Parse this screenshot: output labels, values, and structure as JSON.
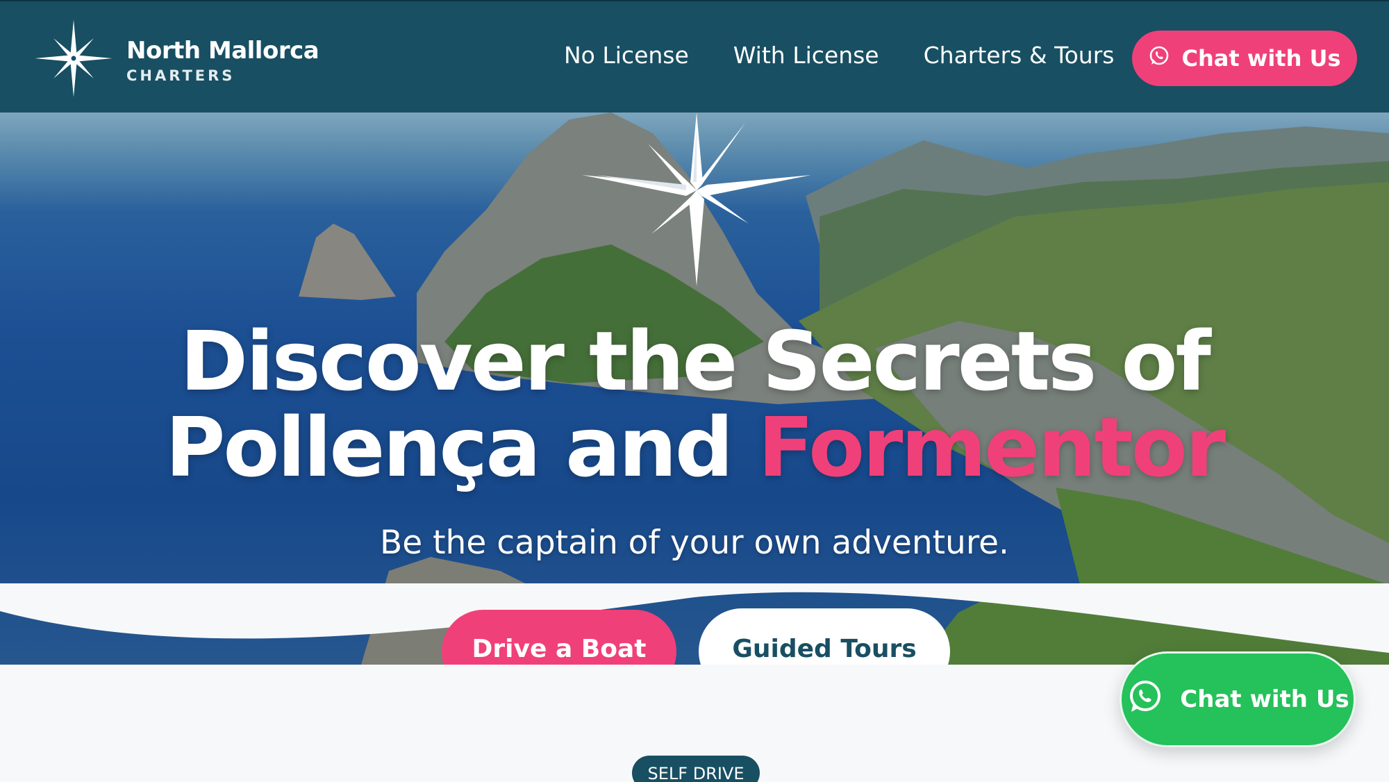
{
  "brand": {
    "title": "North Mallorca",
    "subtitle": "CHARTERS",
    "logo_icon": "compass-star-icon"
  },
  "nav": {
    "items": [
      {
        "label": "No License"
      },
      {
        "label": "With License"
      },
      {
        "label": "Charters & Tours"
      }
    ],
    "chat_button": {
      "label": "Chat with Us",
      "icon": "whatsapp-icon"
    }
  },
  "hero": {
    "headline_line1": "Discover the Secrets of",
    "headline_line2_a": "Pollença and ",
    "headline_line2_accent": "Formentor",
    "tagline": "Be the captain of your own adventure.",
    "primary_button": "Drive a Boat",
    "secondary_button": "Guided Tours"
  },
  "section": {
    "badge": "SELF DRIVE"
  },
  "floating_chat": {
    "label": "Chat with Us",
    "icon": "whatsapp-icon"
  },
  "colors": {
    "header_bg": "#184f62",
    "accent_pink": "#f0407a",
    "whatsapp_green": "#25c15a",
    "page_bg": "#f7f8fa"
  }
}
